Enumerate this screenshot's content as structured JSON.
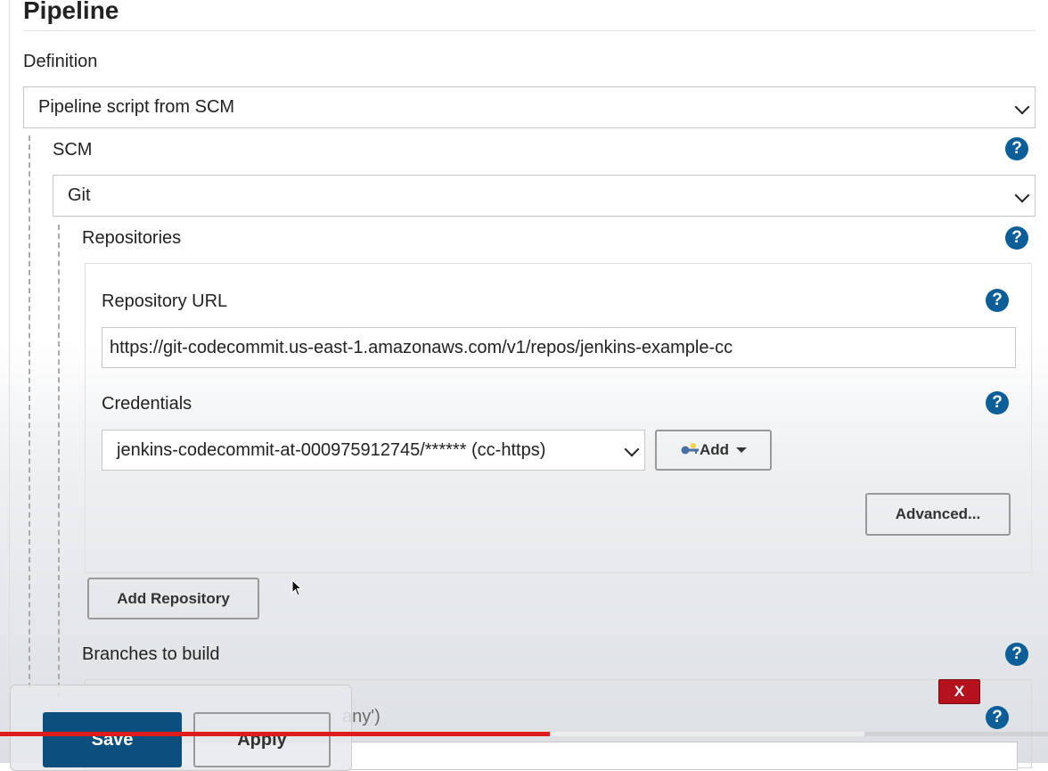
{
  "section": {
    "title": "Pipeline"
  },
  "definition": {
    "label": "Definition",
    "selected": "Pipeline script from SCM"
  },
  "scm": {
    "label": "SCM",
    "selected": "Git"
  },
  "repositories": {
    "label": "Repositories",
    "url_label": "Repository URL",
    "url_value": "https://git-codecommit.us-east-1.amazonaws.com/v1/repos/jenkins-example-cc",
    "credentials_label": "Credentials",
    "credentials_selected": "jenkins-codecommit-at-000975912745/****** (cc-https)",
    "add_label": "Add",
    "advanced_label": "Advanced...",
    "add_repository_label": "Add Repository"
  },
  "branches": {
    "label": "Branches to build",
    "spec_partial": "any')",
    "delete_label": "X"
  },
  "help": {
    "glyph": "?"
  },
  "footer": {
    "save_label": "Save",
    "apply_label": "Apply"
  },
  "video": {
    "progress": 0.525
  },
  "icons": {
    "help": "help-icon",
    "key": "key-icon",
    "chevron": "chevron-down-icon",
    "cursor": "mouse-cursor-icon"
  },
  "colors": {
    "help": "#0b5e97",
    "save": "#0b4f7f",
    "delete": "#b3121e",
    "progress": "#e01b1b"
  }
}
